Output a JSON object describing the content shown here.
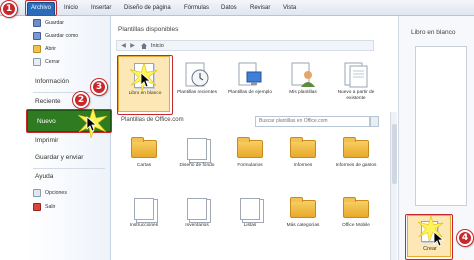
{
  "ribbon": {
    "tabs": [
      "Archivo",
      "Inicio",
      "Insertar",
      "Diseño de página",
      "Fórmulas",
      "Datos",
      "Revisar",
      "Vista"
    ]
  },
  "backstage": {
    "small_items": [
      "Guardar",
      "Guardar como",
      "Abrir",
      "Cerrar"
    ],
    "info": "Información",
    "recent": "Reciente",
    "new": "Nuevo",
    "print": "Imprimir",
    "save_send": "Guardar y enviar",
    "help": "Ayuda",
    "options": "Opciones",
    "exit": "Salir"
  },
  "middle": {
    "title": "Plantillas disponibles",
    "nav_home": "Inicio",
    "templates": [
      {
        "label": "Libro en blanco",
        "icon": "blank-workbook-icon"
      },
      {
        "label": "Plantillas recientes",
        "icon": "clock-icon"
      },
      {
        "label": "Plantillas de ejemplo",
        "icon": "sample-templates-icon"
      },
      {
        "label": "Mis plantillas",
        "icon": "my-templates-icon"
      },
      {
        "label": "Nuevo a partir de existente",
        "icon": "new-from-existing-icon"
      }
    ],
    "office_label": "Plantillas de Office.com",
    "search_placeholder": "Buscar plantillas en Office.com",
    "folders": [
      [
        "Cartas",
        "Diseño de fondo",
        "Formularios",
        "Informes",
        "Informes de gastos"
      ],
      [
        "Instrucciones",
        "Inventarios",
        "Listas",
        "Más categorías",
        "Office Mobile"
      ]
    ]
  },
  "right": {
    "title": "Libro en blanco",
    "create": "Crear"
  },
  "markers": [
    "1",
    "2",
    "3",
    "4"
  ],
  "colors": {
    "accent": "#2a6cb9",
    "nuevo": "#2f7b22",
    "marker": "#c8272c",
    "selection": "#fde8b5"
  }
}
